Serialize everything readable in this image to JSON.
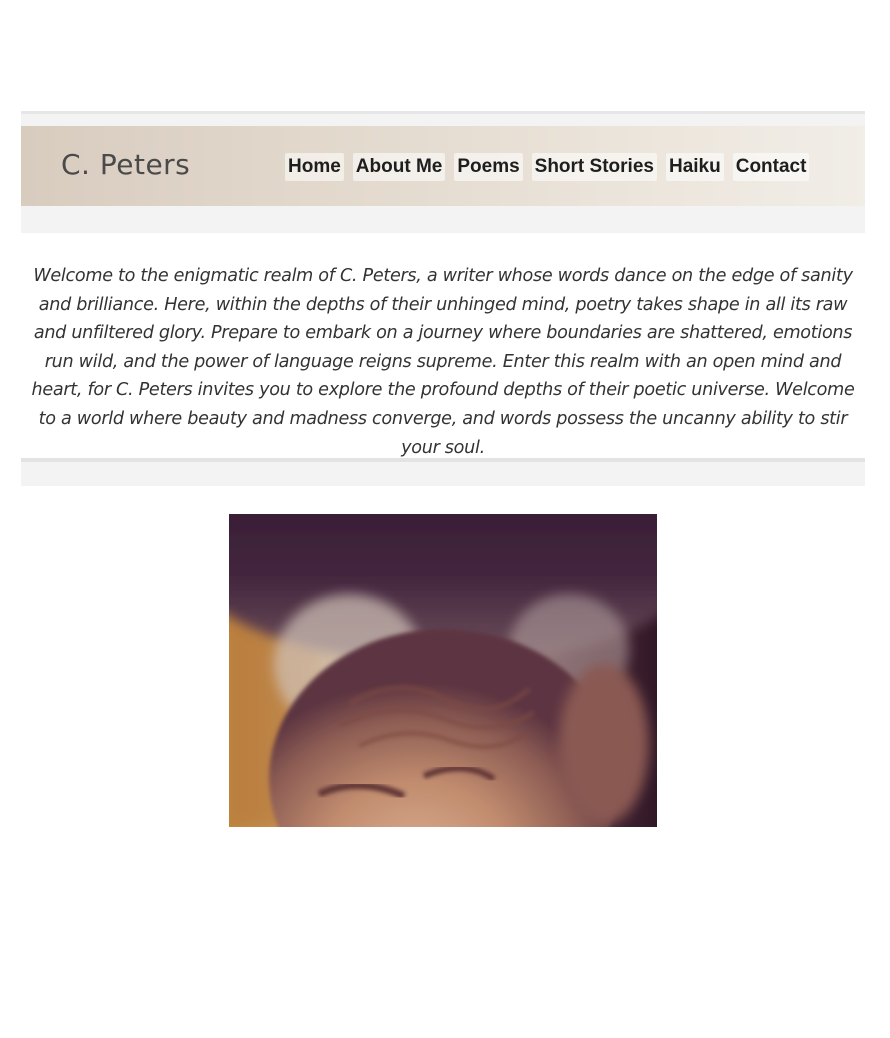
{
  "header": {
    "brand": "C. Peters",
    "nav": [
      {
        "label": "Home"
      },
      {
        "label": "About Me"
      },
      {
        "label": "Poems"
      },
      {
        "label": "Short Stories"
      },
      {
        "label": "Haiku"
      },
      {
        "label": "Contact"
      }
    ]
  },
  "intro": {
    "text": "Welcome to the enigmatic realm of C. Peters, a writer whose words dance on the edge of sanity and brilliance. Here, within the depths of their unhinged mind, poetry takes shape in all its raw and unfiltered glory. Prepare to embark on a journey where boundaries are shattered, emotions run wild, and the power of language reigns supreme. Enter this realm with an open mind and heart, for C. Peters invites you to explore the profound depths of their poetic universe. Welcome to a world where beauty and madness converge, and words possess the uncanny ability to stir your soul."
  },
  "colors": {
    "header_gradient_start": "#d8ccbf",
    "header_gradient_end": "#f1ede7",
    "band": "#f3f3f3",
    "text": "#333333"
  }
}
